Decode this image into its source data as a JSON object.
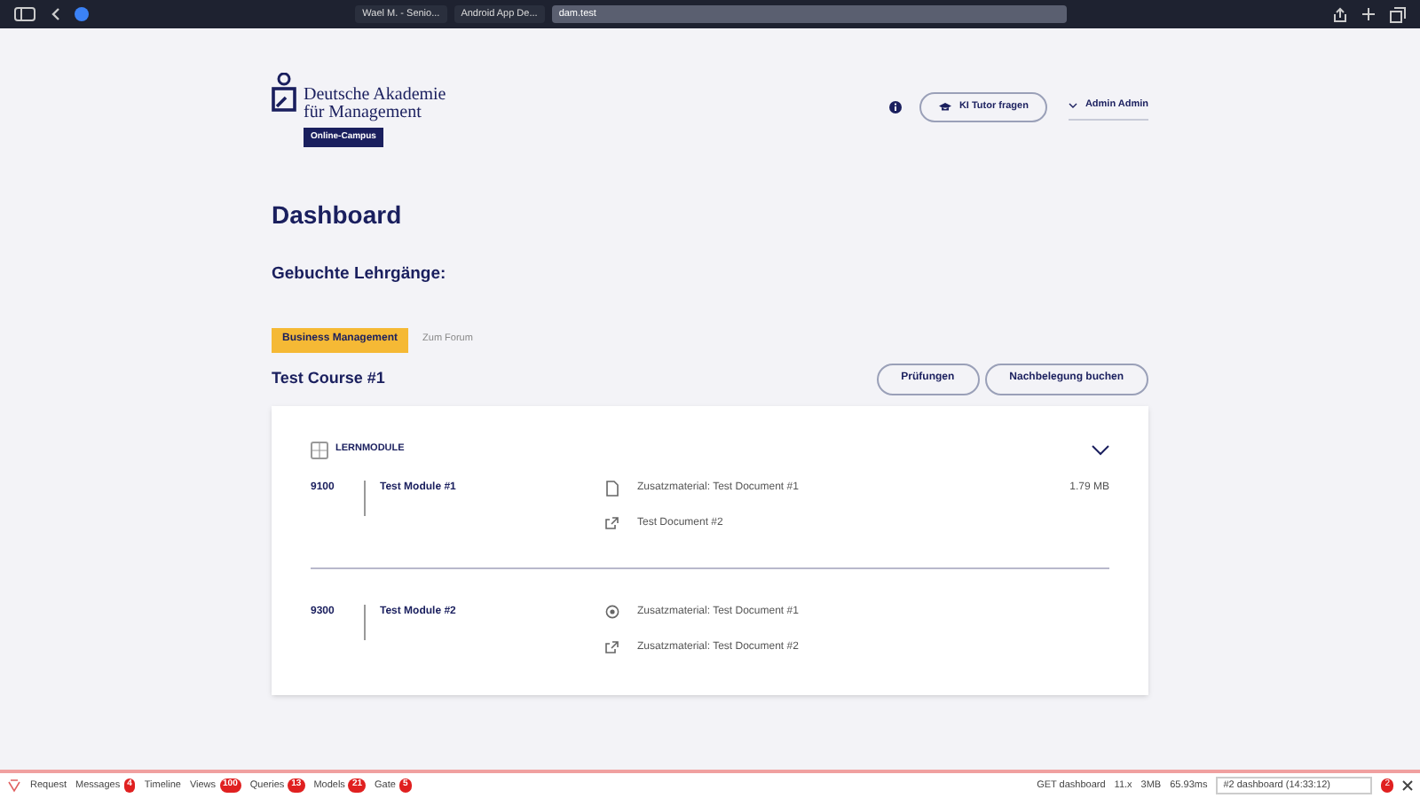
{
  "browser": {
    "tabs": [
      {
        "label": "Wael M. - Senio...",
        "selected": false
      },
      {
        "label": "Android App De...",
        "selected": false
      },
      {
        "label": "dam.test",
        "selected": true
      }
    ]
  },
  "header": {
    "logo_line_1": "Deutsche Akademie",
    "logo_line_2": "für Management",
    "logo_badge": "Online-Campus",
    "tutor_button": "KI Tutor fragen",
    "user": "Admin Admin"
  },
  "title": "Dashboard",
  "subtitle": "Gebuchte Lehrgänge:",
  "course_tabs": [
    {
      "label": "Business Management",
      "selected": true
    },
    {
      "label": "Zum Forum",
      "selected": false
    }
  ],
  "course": {
    "title": "Test Course #1",
    "buttons": [
      "Prüfungen",
      "Nachbelegung buchen"
    ],
    "section": "LERNMODULE",
    "expanded": true,
    "modules": [
      {
        "code": "9100",
        "name": "Test Module #1",
        "documents": [
          {
            "kind": "file",
            "label": "Zusatzmaterial: Test Document #1",
            "size": "1.79 MB"
          },
          {
            "kind": "link",
            "label": "Test Document #2"
          }
        ]
      },
      {
        "code": "9300",
        "name": "Test Module #2",
        "documents": [
          {
            "kind": "media",
            "label": "Zusatzmaterial: Test Document #1"
          },
          {
            "kind": "link",
            "label": "Zusatzmaterial: Test Document #2"
          }
        ]
      }
    ]
  },
  "debugbar": {
    "items": [
      {
        "label": "Request"
      },
      {
        "label": "Messages",
        "count": "4"
      },
      {
        "label": "Timeline"
      },
      {
        "label": "Views",
        "count": "100"
      },
      {
        "label": "Queries",
        "count": "13"
      },
      {
        "label": "Models",
        "count": "21"
      },
      {
        "label": "Gate",
        "count": "5"
      }
    ],
    "route": "GET dashboard",
    "php": "11.x",
    "memory": "3MB",
    "time": "65.93ms",
    "request": "#2 dashboard (14:33:12)",
    "history_count": "2"
  }
}
